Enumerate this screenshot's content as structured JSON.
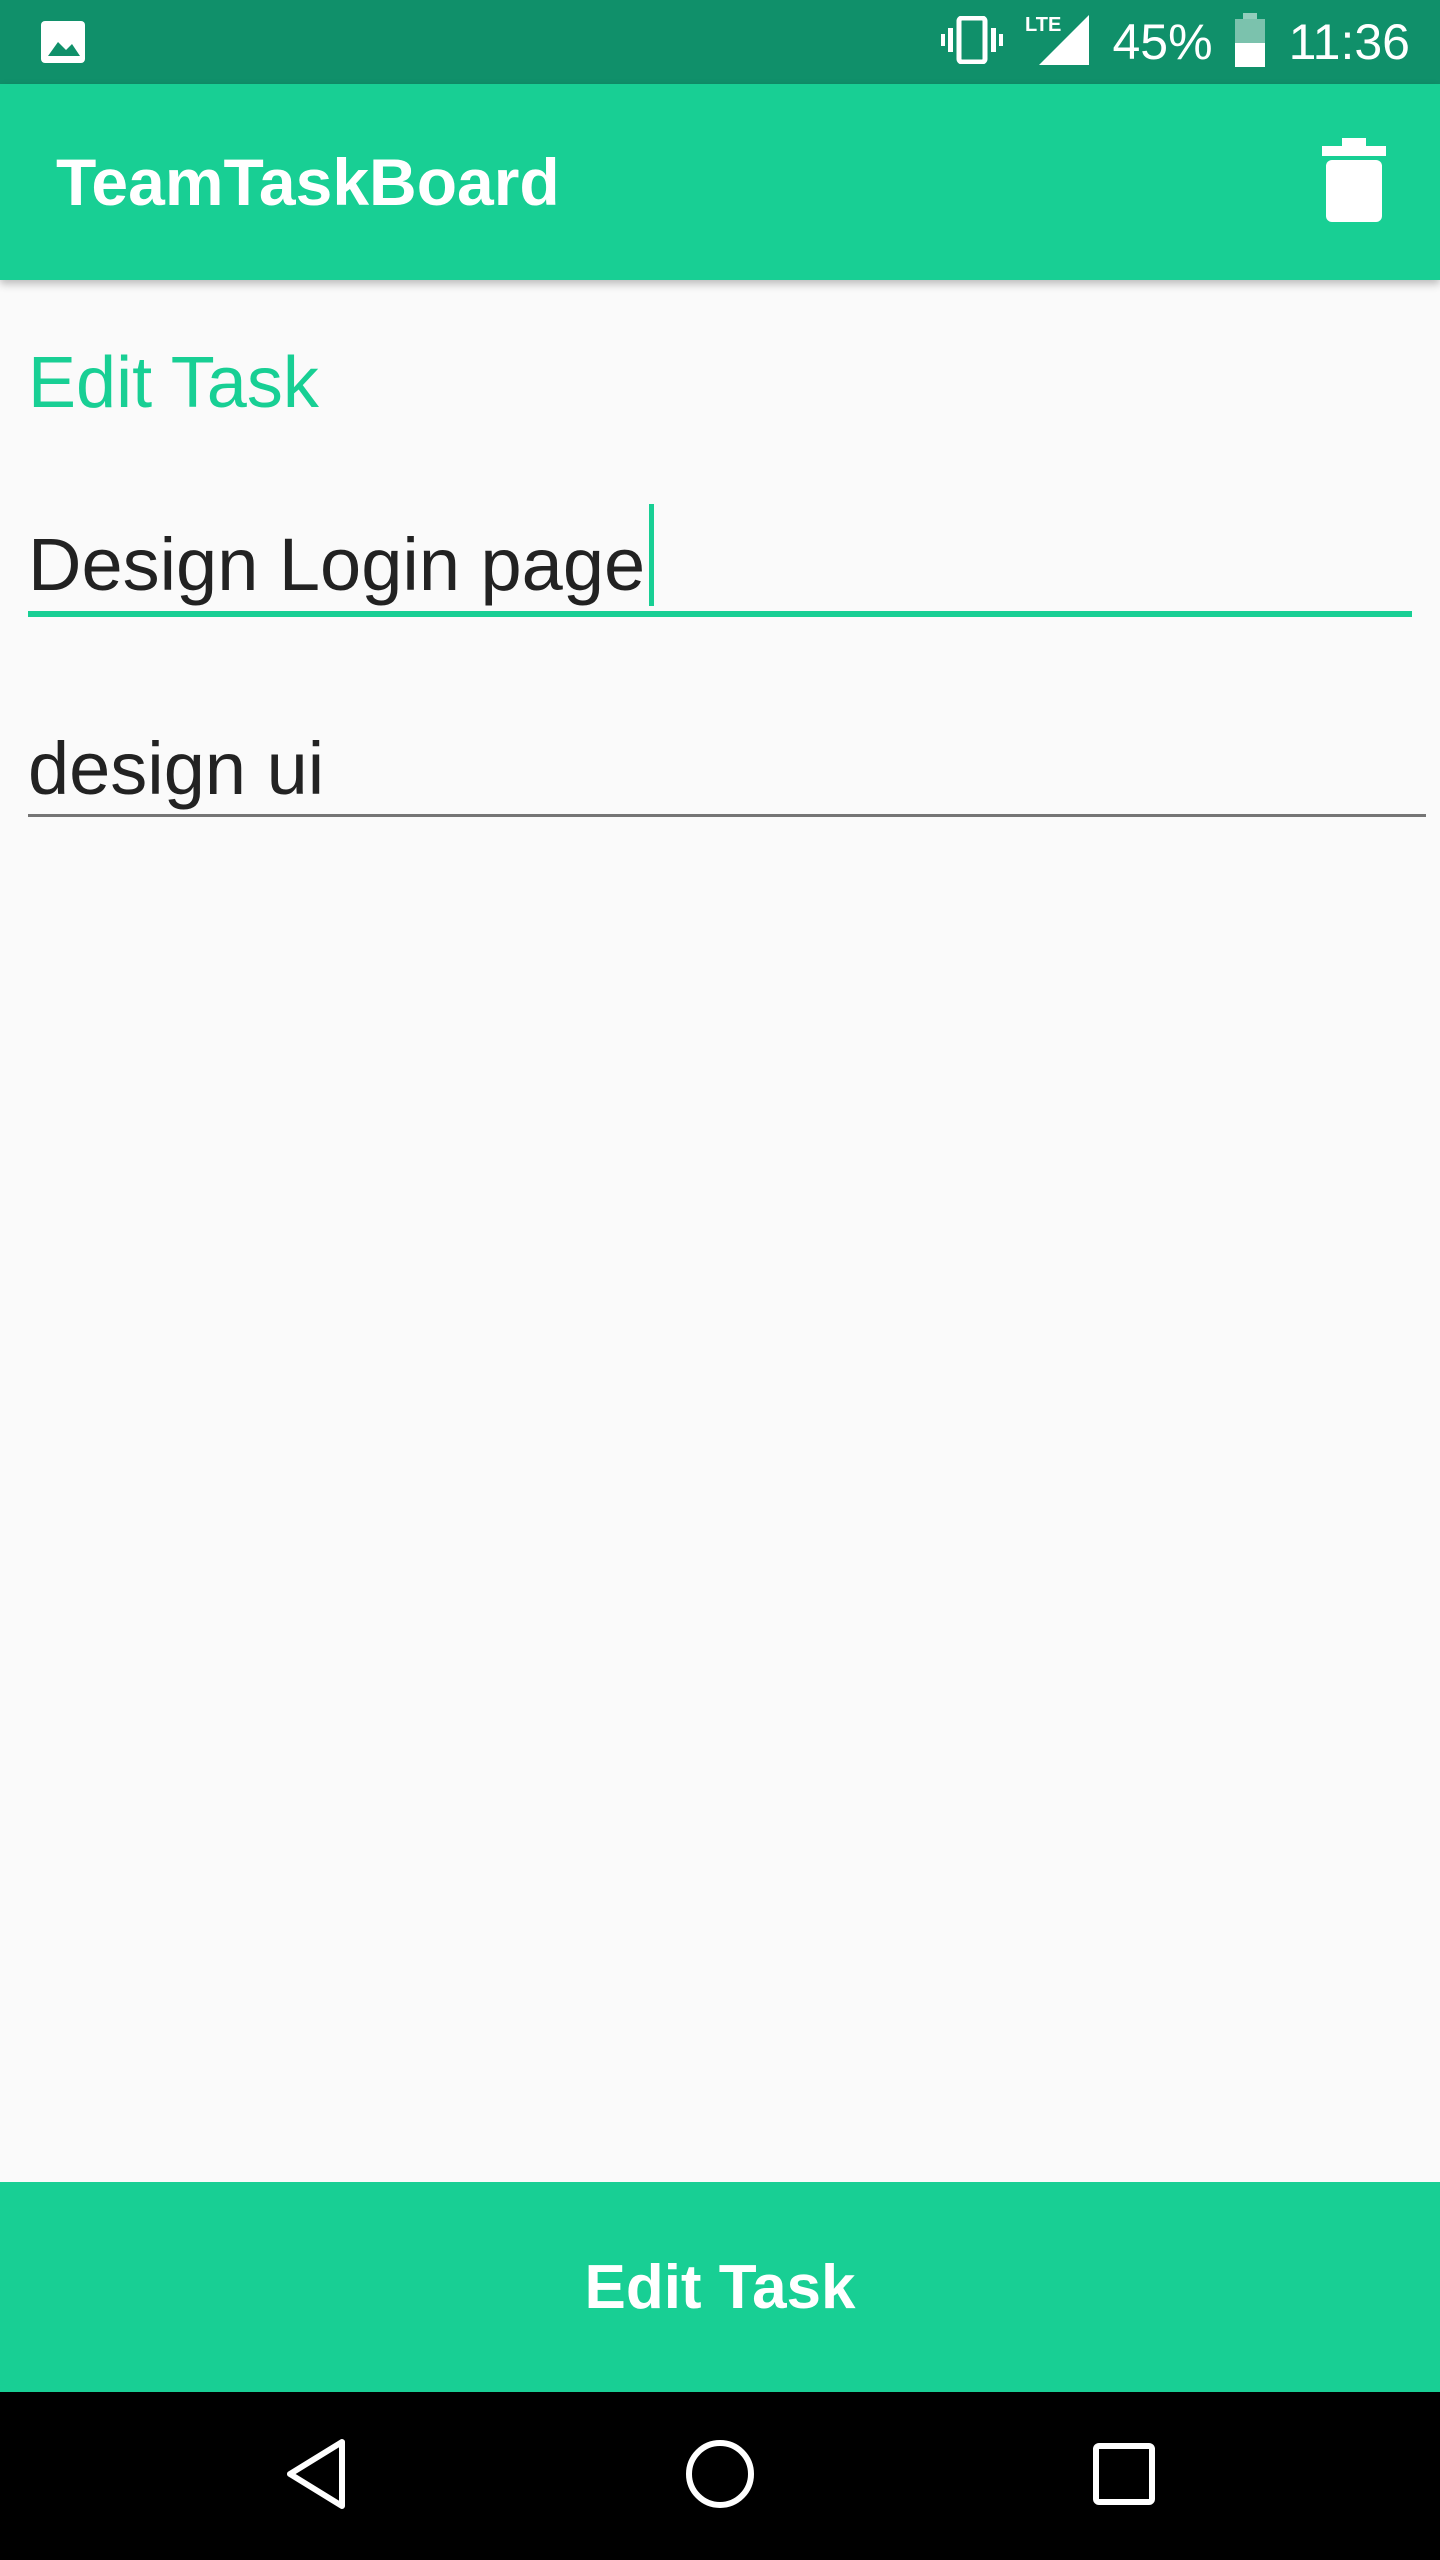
{
  "status_bar": {
    "battery_percent": "45%",
    "time": "11:36",
    "network": "LTE"
  },
  "app_bar": {
    "title": "TeamTaskBoard"
  },
  "form": {
    "heading": "Edit Task",
    "title_value": "Design Login page",
    "description_value": "design ui"
  },
  "submit_label": "Edit Task",
  "colors": {
    "status_bar": "#10906a",
    "accent": "#18cf94",
    "background": "#fafafa",
    "text": "#222222"
  },
  "icons": {
    "status_left": "image-icon",
    "vibrate": "vibrate-icon",
    "signal": "signal-icon",
    "battery": "battery-icon",
    "delete": "trash-icon",
    "nav_back": "back-icon",
    "nav_home": "home-icon",
    "nav_recents": "recents-icon"
  }
}
